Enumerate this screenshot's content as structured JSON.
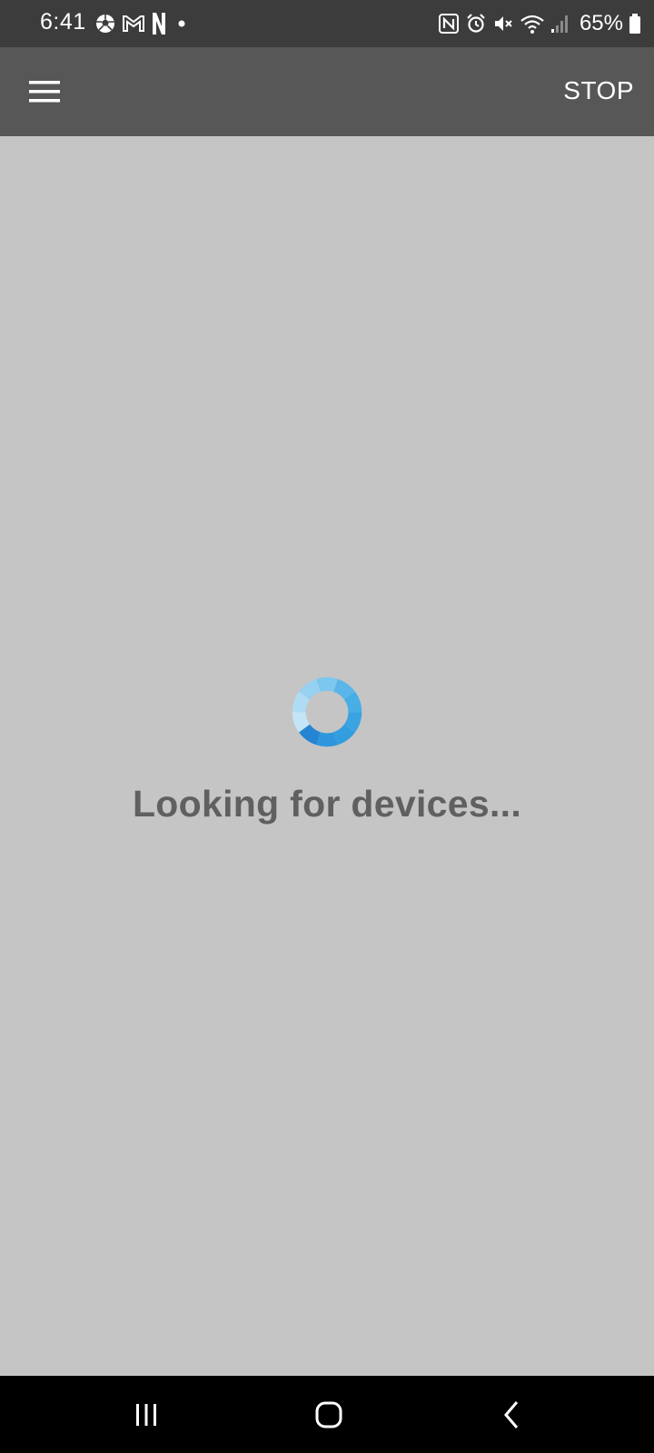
{
  "status_bar": {
    "time": "6:41",
    "battery_percent": "65%",
    "left_icons": [
      "soccer-ball-icon",
      "gmail-icon",
      "netflix-icon",
      "dot-icon"
    ],
    "right_icons": [
      "nfc-icon",
      "alarm-icon",
      "mute-icon",
      "wifi-icon",
      "signal-icon",
      "battery-icon"
    ]
  },
  "app_bar": {
    "menu_icon": "hamburger-menu-icon",
    "stop_label": "STOP"
  },
  "main": {
    "message": "Looking for devices..."
  },
  "nav_bar": {
    "buttons": [
      "recent-apps-icon",
      "home-icon",
      "back-icon"
    ]
  },
  "colors": {
    "status_bar_bg": "#3c3c3c",
    "app_bar_bg": "#575757",
    "content_bg": "#c5c5c5",
    "message_text": "#606060",
    "spinner_blue": "#2b8fd6"
  }
}
